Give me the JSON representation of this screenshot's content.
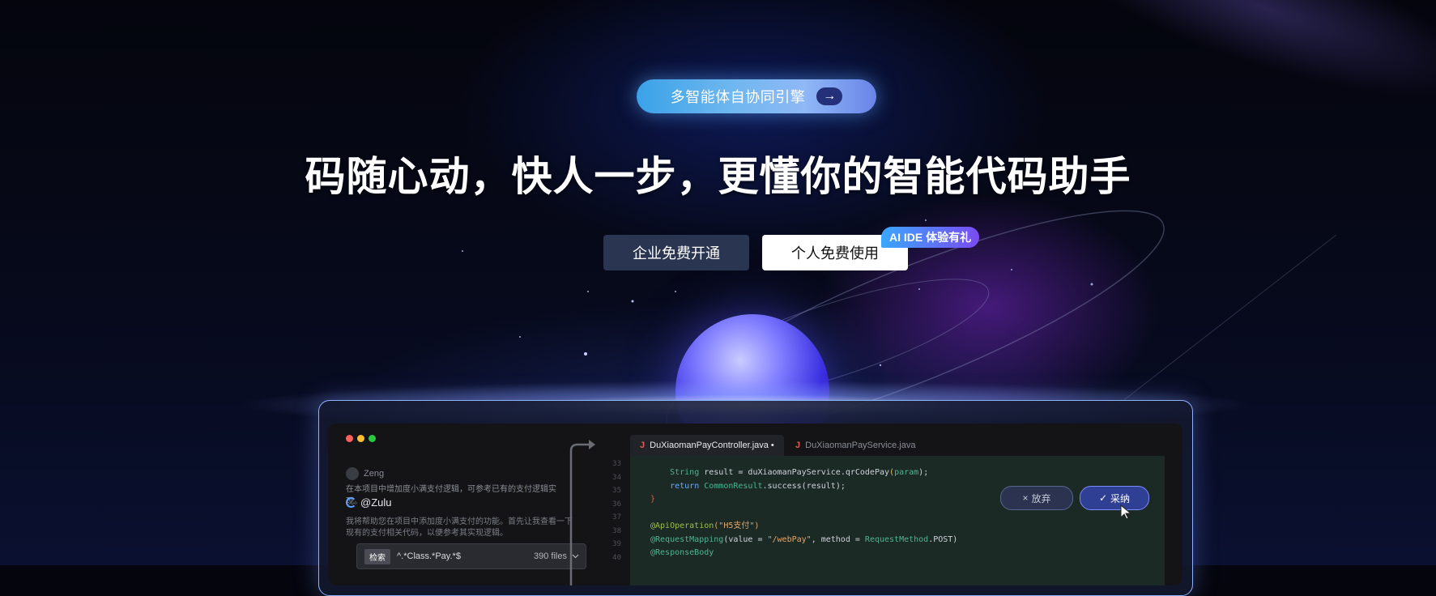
{
  "hero": {
    "badge_text": "多智能体自协同引擎",
    "badge_arrow": "→",
    "headline": "码随心动，快人一步，更懂你的智能代码助手",
    "enterprise_button": "企业免费开通",
    "personal_button": "个人免费使用",
    "promo_tag": "AI IDE 体验有礼"
  },
  "ide": {
    "chat": {
      "user_name": "Zeng",
      "user_message": "在本项目中增加度小满支付逻辑，可参考已有的支付逻辑实现。",
      "agent_name": "@Zulu",
      "agent_reply": "我将帮助您在项目中添加度小满支付的功能。首先让我查看一下现有的支付相关代码，以便参考其实现逻辑。",
      "search_tag": "检索",
      "search_pattern": "^.*Class.*Pay.*$",
      "search_count": "390 files"
    },
    "tabs": [
      {
        "label": "DuXiaomanPayController.java •",
        "icon": "J"
      },
      {
        "label": "DuXiaomanPayService.java",
        "icon": "J"
      }
    ],
    "line_numbers": [
      "33",
      "34",
      "35",
      "36",
      "37",
      "38",
      "39",
      "40"
    ],
    "code": {
      "l1_type": "String",
      "l1_rest": " result = duXiaomanPayService.qrCodePay",
      "l1_paren": "(",
      "l1_arg": "param",
      "l1_end": ");",
      "l2_kw": "return",
      "l2_type": "CommonResult",
      "l2_rest": ".success",
      "l2_args": "(result);",
      "l3": "}",
      "l5_ann": "@ApiOperation",
      "l5_str": "(\"H5支付\")",
      "l6_ann": "@RequestMapping",
      "l6_rest": "(value = ",
      "l6_str": "\"/webPay\"",
      "l6_mid": ", method = ",
      "l6_type": "RequestMethod",
      "l6_end": ".POST)",
      "l7_ann": "@ResponseBody"
    },
    "discard_label": "放弃",
    "accept_label": "采纳",
    "discard_icon": "×",
    "accept_icon": "✓"
  },
  "colors": {
    "accent": "#3aa2e8",
    "brand_purple": "#7a4bf2",
    "frame_border": "#8fb2ff"
  }
}
